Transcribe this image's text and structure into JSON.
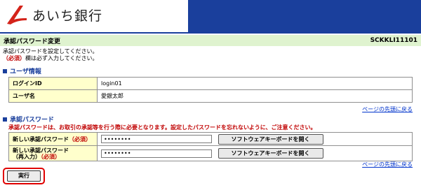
{
  "header": {
    "bank_name": "あいち銀行",
    "brand_color": "#1a3f9c",
    "logo_color": "#d4231a"
  },
  "titlebar": {
    "title": "承認パスワード変更",
    "screen_code": "SCKKLI11101"
  },
  "intro": {
    "line1": "承認パスワードを設定してください。",
    "required_tag": "（必須）",
    "line2_rest": "欄は必ず入力してください。"
  },
  "user_section": {
    "heading": "ユーザ情報",
    "rows": [
      {
        "label": "ログインID",
        "value": "login01"
      },
      {
        "label": "ユーザ名",
        "value": "愛銀太郎"
      }
    ]
  },
  "back_link_label": "ページの先頭に戻る",
  "pw_section": {
    "heading": "承認パスワード",
    "warning": "承認パスワードは、お取引の承認等を行う際に必要となります。設定したパスワードを忘れないように、ご注意ください。",
    "new_pw_label": "新しい承認パスワード",
    "confirm_label_line1": "新しい承認パスワード",
    "confirm_label_line2": "（再入力）",
    "required_tag": "（必須）",
    "new_pw_value": "••••••••",
    "confirm_value": "••••••••",
    "keyboard_button": "ソフトウェアキーボードを開く"
  },
  "submit_label": "実行"
}
